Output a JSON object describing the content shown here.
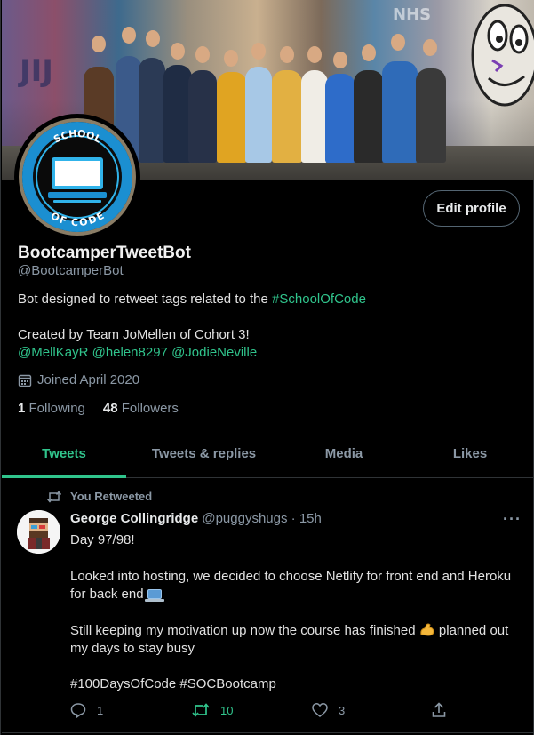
{
  "banner": {
    "graffiti_tags": [
      "NHS",
      "JIJ"
    ]
  },
  "avatar": {
    "badge_top": "SCHOOL",
    "badge_bottom": "OF CODE",
    "colors": {
      "ring": "#1b8fd1",
      "accent": "#30b3ea",
      "frame": "#8a7d66"
    }
  },
  "profile": {
    "edit_label": "Edit profile",
    "name": "BootcamperTweetBot",
    "handle": "@BootcamperBot",
    "bio_text": "Bot designed to retweet tags related to the ",
    "bio_hashtag": "#SchoolOfCode",
    "bio_line2": "Created by Team JoMellen of Cohort 3!",
    "mentions": [
      "@MellKayR",
      "@helen8297",
      "@JodieNeville"
    ],
    "joined": "Joined April 2020",
    "following_count": "1",
    "following_label": "Following",
    "followers_count": "48",
    "followers_label": "Followers"
  },
  "tabs": [
    {
      "label": "Tweets",
      "active": true
    },
    {
      "label": "Tweets & replies",
      "active": false
    },
    {
      "label": "Media",
      "active": false
    },
    {
      "label": "Likes",
      "active": false
    }
  ],
  "tweet": {
    "retweet_label": "You Retweeted",
    "author_name": "George Collingridge",
    "author_handle": "@puggyshugs",
    "separator": "·",
    "time": "15h",
    "more_label": "···",
    "line1": "Day 97/98!",
    "line2": "Looked into hosting, we decided to choose Netlify for front end and Heroku",
    "line3": "for back end",
    "line4_a": "Still keeping my motivation up now the course has finished",
    "line4_b": "planned out",
    "line5": "my days to stay busy",
    "hashtags": "#100DaysOfCode #SOCBootcamp",
    "reply_count": "1",
    "retweet_count": "10",
    "like_count": "3"
  },
  "colors": {
    "accent": "#30c48c",
    "background": "#000000",
    "secondary_text": "#8b98a5",
    "border": "#2f3336"
  },
  "icons": [
    "calendar-icon",
    "retweet-icon",
    "reply-icon",
    "like-icon",
    "share-icon",
    "more-icon",
    "laptop-emoji",
    "muscle-emoji"
  ]
}
